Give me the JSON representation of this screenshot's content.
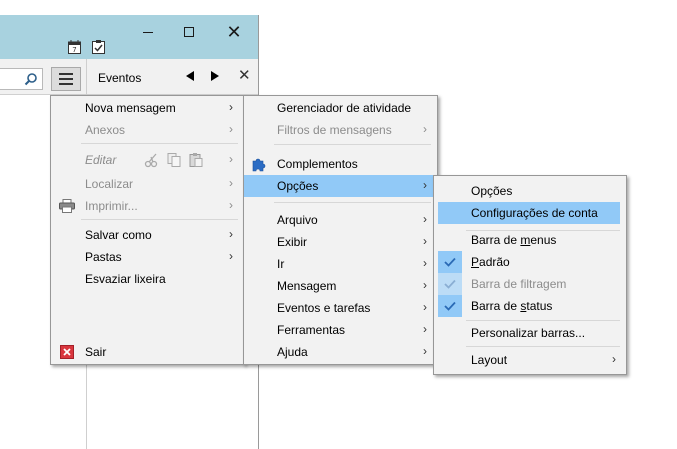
{
  "window": {
    "events_label": "Eventos"
  },
  "main_menu": {
    "items": [
      {
        "label": "Nova mensagem",
        "enabled": true,
        "submenu": true
      },
      {
        "label": "Anexos",
        "enabled": false,
        "submenu": true
      },
      {
        "label": "Editar",
        "enabled": false,
        "submenu": true
      },
      {
        "label": "Localizar",
        "enabled": false,
        "submenu": true
      },
      {
        "label": "Imprimir...",
        "enabled": false,
        "submenu": true
      },
      {
        "label": "Salvar como",
        "enabled": true,
        "submenu": true
      },
      {
        "label": "Pastas",
        "enabled": true,
        "submenu": true
      },
      {
        "label": "Esvaziar lixeira",
        "enabled": true,
        "submenu": false
      },
      {
        "label": "Sair",
        "enabled": true,
        "submenu": false
      }
    ]
  },
  "submenu": {
    "items": [
      {
        "label": "Gerenciador de atividade",
        "enabled": true
      },
      {
        "label": "Filtros de mensagens",
        "enabled": false
      },
      {
        "label": "Complementos",
        "enabled": true
      },
      {
        "label": "Opções",
        "enabled": true,
        "highlighted": true
      },
      {
        "label": "Arquivo",
        "enabled": true
      },
      {
        "label": "Exibir",
        "enabled": true
      },
      {
        "label": "Ir",
        "enabled": true
      },
      {
        "label": "Mensagem",
        "enabled": true
      },
      {
        "label": "Eventos e tarefas",
        "enabled": true
      },
      {
        "label": "Ferramentas",
        "enabled": true
      },
      {
        "label": "Ajuda",
        "enabled": true
      }
    ]
  },
  "options_menu": {
    "items": [
      {
        "label": "Opções"
      },
      {
        "label": "Configurações de conta",
        "highlighted": true
      },
      {
        "label_pre": "Barra de ",
        "label_u": "m",
        "label_post": "enus",
        "checked": false
      },
      {
        "label_pre": "",
        "label_u": "P",
        "label_post": "adrão",
        "checked": true
      },
      {
        "label_pre": "Barra de filtragem",
        "label_u": "",
        "label_post": "",
        "checked": true,
        "enabled": false
      },
      {
        "label_pre": "Barra de ",
        "label_u": "s",
        "label_post": "tatus",
        "checked": true
      },
      {
        "label": "Personalizar barras..."
      },
      {
        "label": "Layout"
      }
    ]
  },
  "colors": {
    "titlebar": "#a8d2df",
    "highlight": "#91c9f7",
    "menu_bg": "#f2f2f2",
    "check": "#2a6ab5"
  },
  "icons": {
    "arrow": "›"
  }
}
